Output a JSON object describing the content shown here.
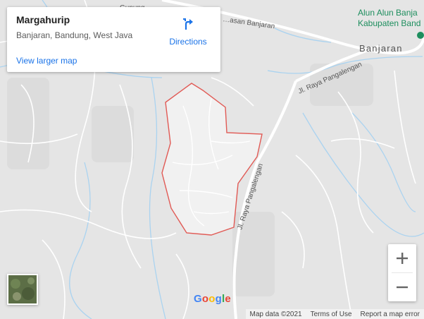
{
  "map": {
    "labels": {
      "road_top": "Jl. Raya Pangalengan",
      "road_vertical": "Jl. Raya Pangalengan",
      "road_banjaran_top": "…asan Banjaran",
      "town": "Banjaran",
      "poi_line1": "Alun Alun Banja",
      "poi_line2": "Kabupaten Band",
      "top_clipped": "Gunung…"
    },
    "colors": {
      "land": "#e5e5e5",
      "area_fill": "#f2f2f2",
      "boundary": "#e15a55",
      "roads": "#ffffff",
      "water": "#aad3f0",
      "poi_text": "#1e8e5e"
    }
  },
  "info_card": {
    "name": "Margahurip",
    "address": "Banjaran, Bandung, West Java",
    "view_larger": "View larger map",
    "directions_label": "Directions",
    "directions_icon": "directions-arrow-icon"
  },
  "controls": {
    "zoom_in": "+",
    "zoom_out": "−",
    "map_type_icon": "satellite-thumbnail"
  },
  "logo": {
    "letters": [
      "G",
      "o",
      "o",
      "g",
      "l",
      "e"
    ],
    "colors": [
      "#4285f4",
      "#ea4335",
      "#fbbc05",
      "#4285f4",
      "#34a853",
      "#ea4335"
    ]
  },
  "footer": {
    "map_data": "Map data ©2021",
    "terms": "Terms of Use",
    "report": "Report a map error"
  }
}
